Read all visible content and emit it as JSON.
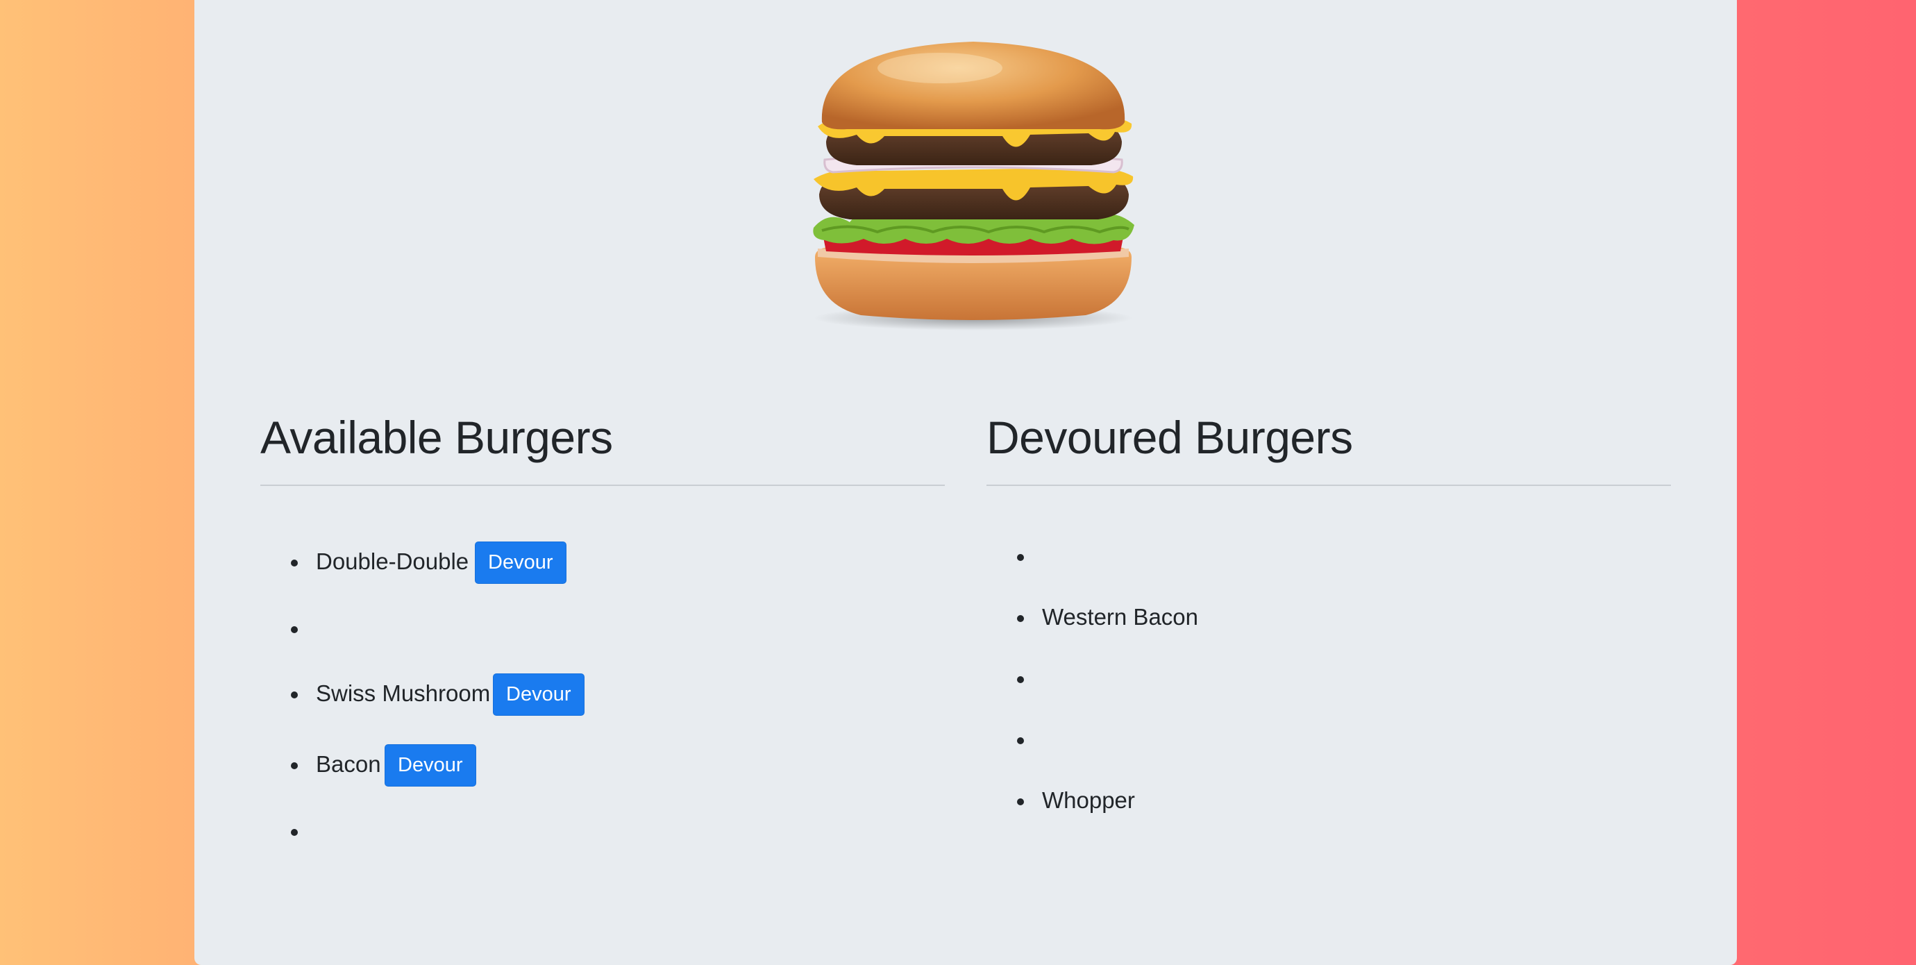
{
  "available": {
    "heading": "Available Burgers",
    "items": [
      {
        "name": "Double-Double",
        "button": "Devour"
      },
      {
        "name": "",
        "button": ""
      },
      {
        "name": "Swiss Mushroom",
        "button": "Devour"
      },
      {
        "name": "Bacon",
        "button": "Devour"
      },
      {
        "name": "",
        "button": ""
      }
    ]
  },
  "devoured": {
    "heading": "Devoured Burgers",
    "items": [
      {
        "name": ""
      },
      {
        "name": "Western Bacon"
      },
      {
        "name": ""
      },
      {
        "name": ""
      },
      {
        "name": "Whopper"
      }
    ]
  },
  "colors": {
    "button": "#1a7bef",
    "panel": "#e8ecf0",
    "background_left": "#ffc177",
    "background_right": "#ff6470"
  },
  "hero_image": {
    "icon": "burger-image"
  }
}
